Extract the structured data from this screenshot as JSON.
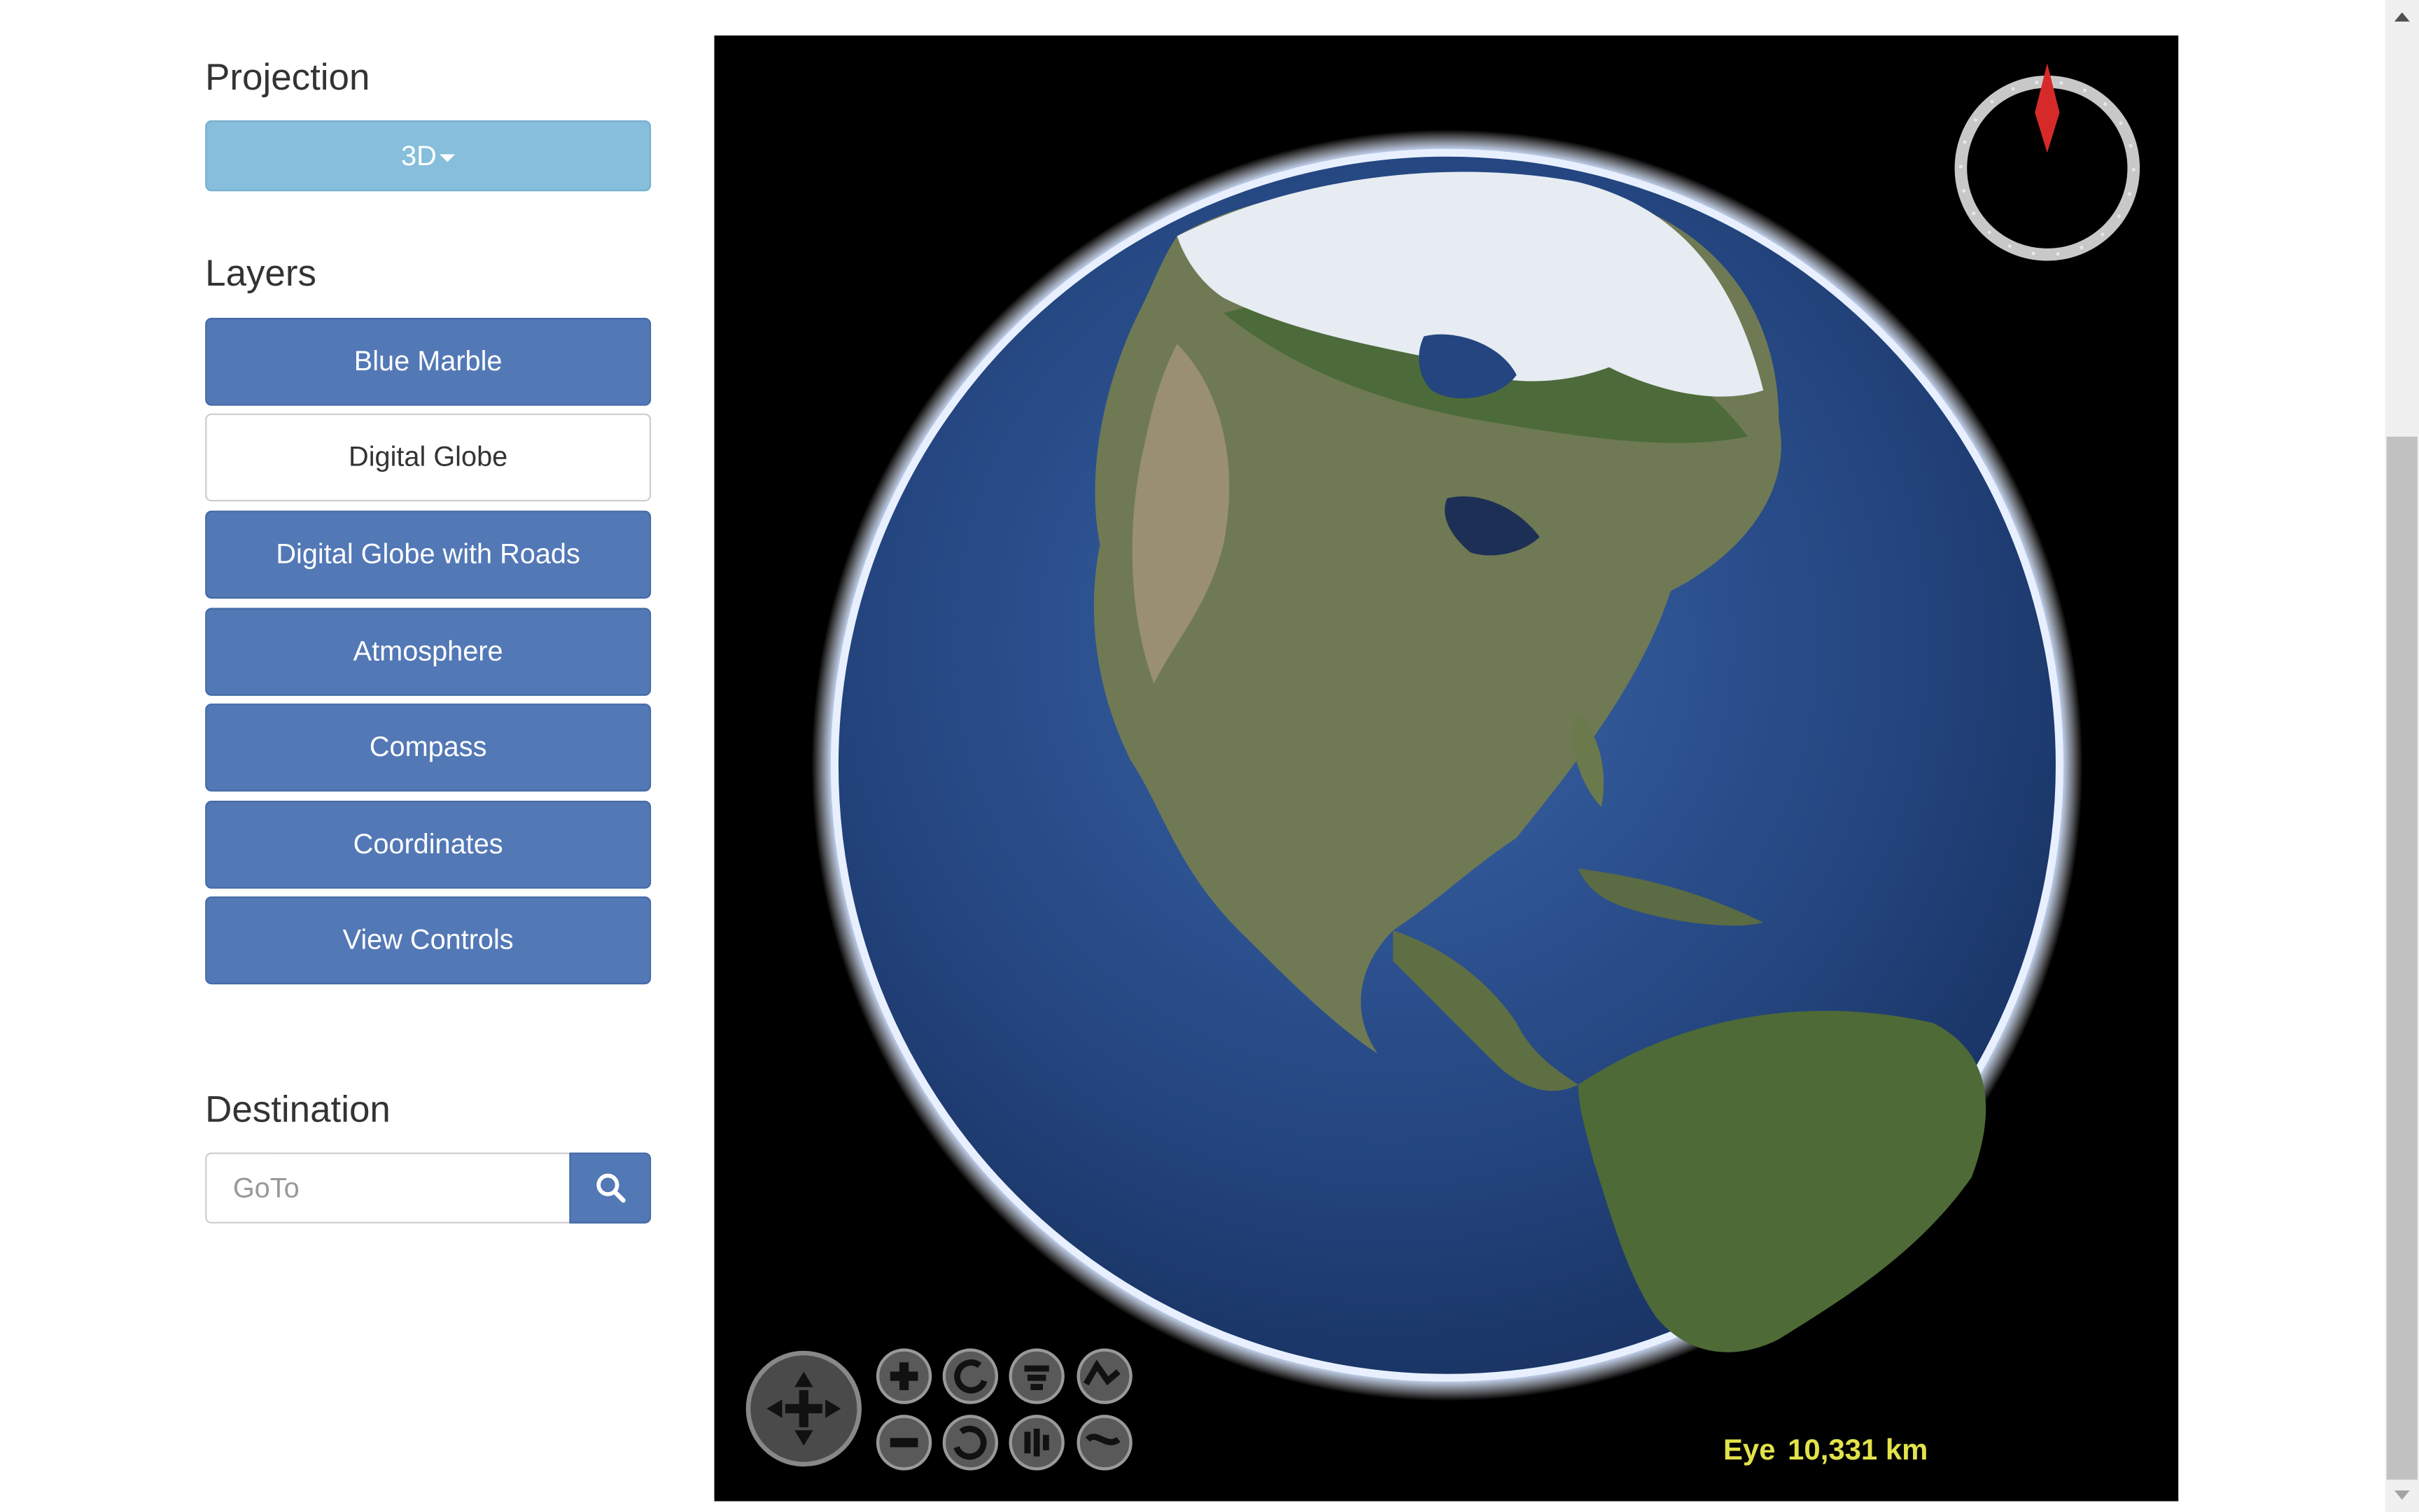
{
  "projection": {
    "title": "Projection",
    "selected": "3D"
  },
  "layers": {
    "title": "Layers",
    "items": [
      {
        "label": "Blue Marble",
        "active": true
      },
      {
        "label": "Digital Globe",
        "active": false
      },
      {
        "label": "Digital Globe with Roads",
        "active": true
      },
      {
        "label": "Atmosphere",
        "active": true
      },
      {
        "label": "Compass",
        "active": true
      },
      {
        "label": "Coordinates",
        "active": true
      },
      {
        "label": "View Controls",
        "active": true
      }
    ]
  },
  "destination": {
    "title": "Destination",
    "placeholder": "GoTo",
    "value": "",
    "search_icon": "search-icon"
  },
  "globe": {
    "eye_label": "Eye",
    "eye_value": "10,331 km",
    "controls": [
      "pan-icon",
      "zoom-in-icon",
      "zoom-out-icon",
      "rotate-ccw-icon",
      "rotate-cw-icon",
      "tilt-up-icon",
      "tilt-down-icon",
      "fov-wide-icon",
      "fov-narrow-icon"
    ],
    "compass_icon": "compass-icon"
  },
  "colors": {
    "primary_button": "#5378b6",
    "info_button": "#86bedb",
    "eye_text": "#e2e24b",
    "compass_needle": "#d62a2a"
  }
}
